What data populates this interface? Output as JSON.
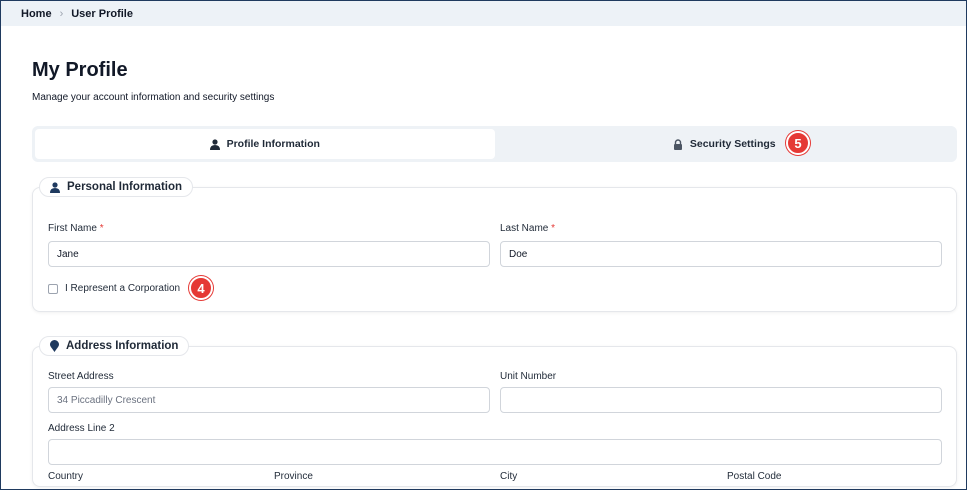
{
  "breadcrumb": {
    "home": "Home",
    "current": "User Profile"
  },
  "page": {
    "title": "My Profile",
    "subtitle": "Manage your account information and security settings"
  },
  "tabs": [
    {
      "label": "Profile Information",
      "icon": "user-icon",
      "active": true
    },
    {
      "label": "Security Settings",
      "icon": "lock-icon",
      "active": false
    }
  ],
  "badges": {
    "security": "5",
    "corporation": "4"
  },
  "personal": {
    "title": "Personal Information",
    "first_name_label": "First Name",
    "first_name": "Jane",
    "last_name_label": "Last Name",
    "last_name": "Doe",
    "required_mark": "*",
    "corporation_label": "I Represent a Corporation",
    "corporation_checked": false
  },
  "address": {
    "title": "Address Information",
    "street_label": "Street Address",
    "street_value": "34 Piccadilly Crescent",
    "unit_label": "Unit Number",
    "unit_value": "",
    "line2_label": "Address Line 2",
    "line2_value": "",
    "country_label": "Country",
    "province_label": "Province",
    "city_label": "City",
    "postal_label": "Postal Code"
  },
  "colors": {
    "badge": "#e53935",
    "frame": "#1f3a5f",
    "breadcrumb_bg": "#edf2f7"
  }
}
